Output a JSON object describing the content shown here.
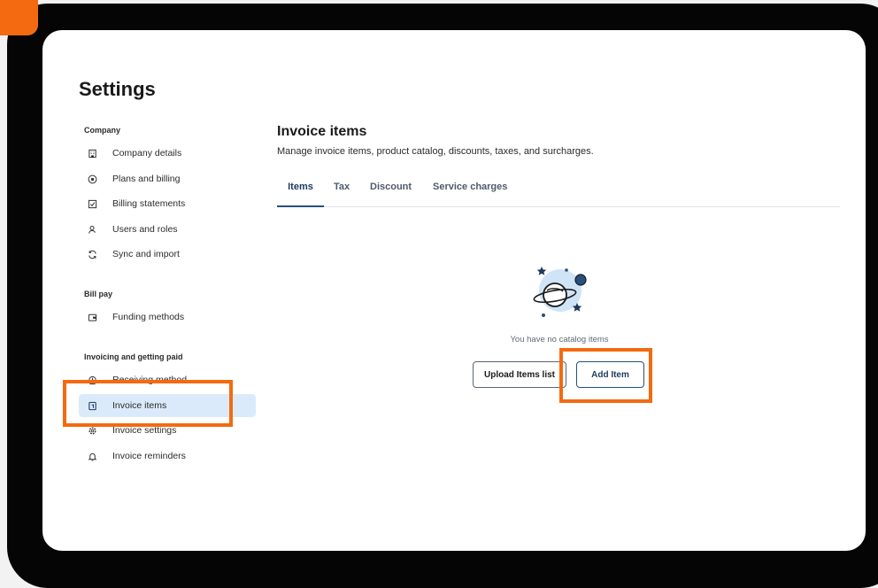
{
  "page": {
    "title": "Settings"
  },
  "sidebar": {
    "sections": [
      {
        "label": "Company",
        "items": [
          {
            "label": "Company details",
            "icon": "building-icon"
          },
          {
            "label": "Plans and billing",
            "icon": "star-circle-icon"
          },
          {
            "label": "Billing statements",
            "icon": "statement-icon"
          },
          {
            "label": "Users and roles",
            "icon": "user-icon"
          },
          {
            "label": "Sync and import",
            "icon": "sync-icon"
          }
        ]
      },
      {
        "label": "Bill pay",
        "items": [
          {
            "label": "Funding methods",
            "icon": "wallet-icon"
          }
        ]
      },
      {
        "label": "Invoicing and getting paid",
        "items": [
          {
            "label": "Receiving method",
            "icon": "receive-icon"
          },
          {
            "label": "Invoice items",
            "icon": "invoice-icon",
            "active": true
          },
          {
            "label": "Invoice settings",
            "icon": "gear-icon"
          },
          {
            "label": "Invoice reminders",
            "icon": "bell-icon"
          }
        ]
      }
    ]
  },
  "main": {
    "title": "Invoice items",
    "subtitle": "Manage invoice items, product catalog, discounts, taxes, and surcharges.",
    "tabs": [
      {
        "label": "Items",
        "active": true
      },
      {
        "label": "Tax"
      },
      {
        "label": "Discount"
      },
      {
        "label": "Service charges"
      }
    ],
    "empty_state": {
      "message": "You have no catalog items",
      "illustration": "planet-stars-illustration"
    },
    "buttons": {
      "upload_label": "Upload Items list",
      "add_label": "Add Item"
    }
  },
  "colors": {
    "highlight": "#f36a10",
    "active_nav_bg": "#dbeafb",
    "accent": "#27507e",
    "bezel": "#050505"
  }
}
